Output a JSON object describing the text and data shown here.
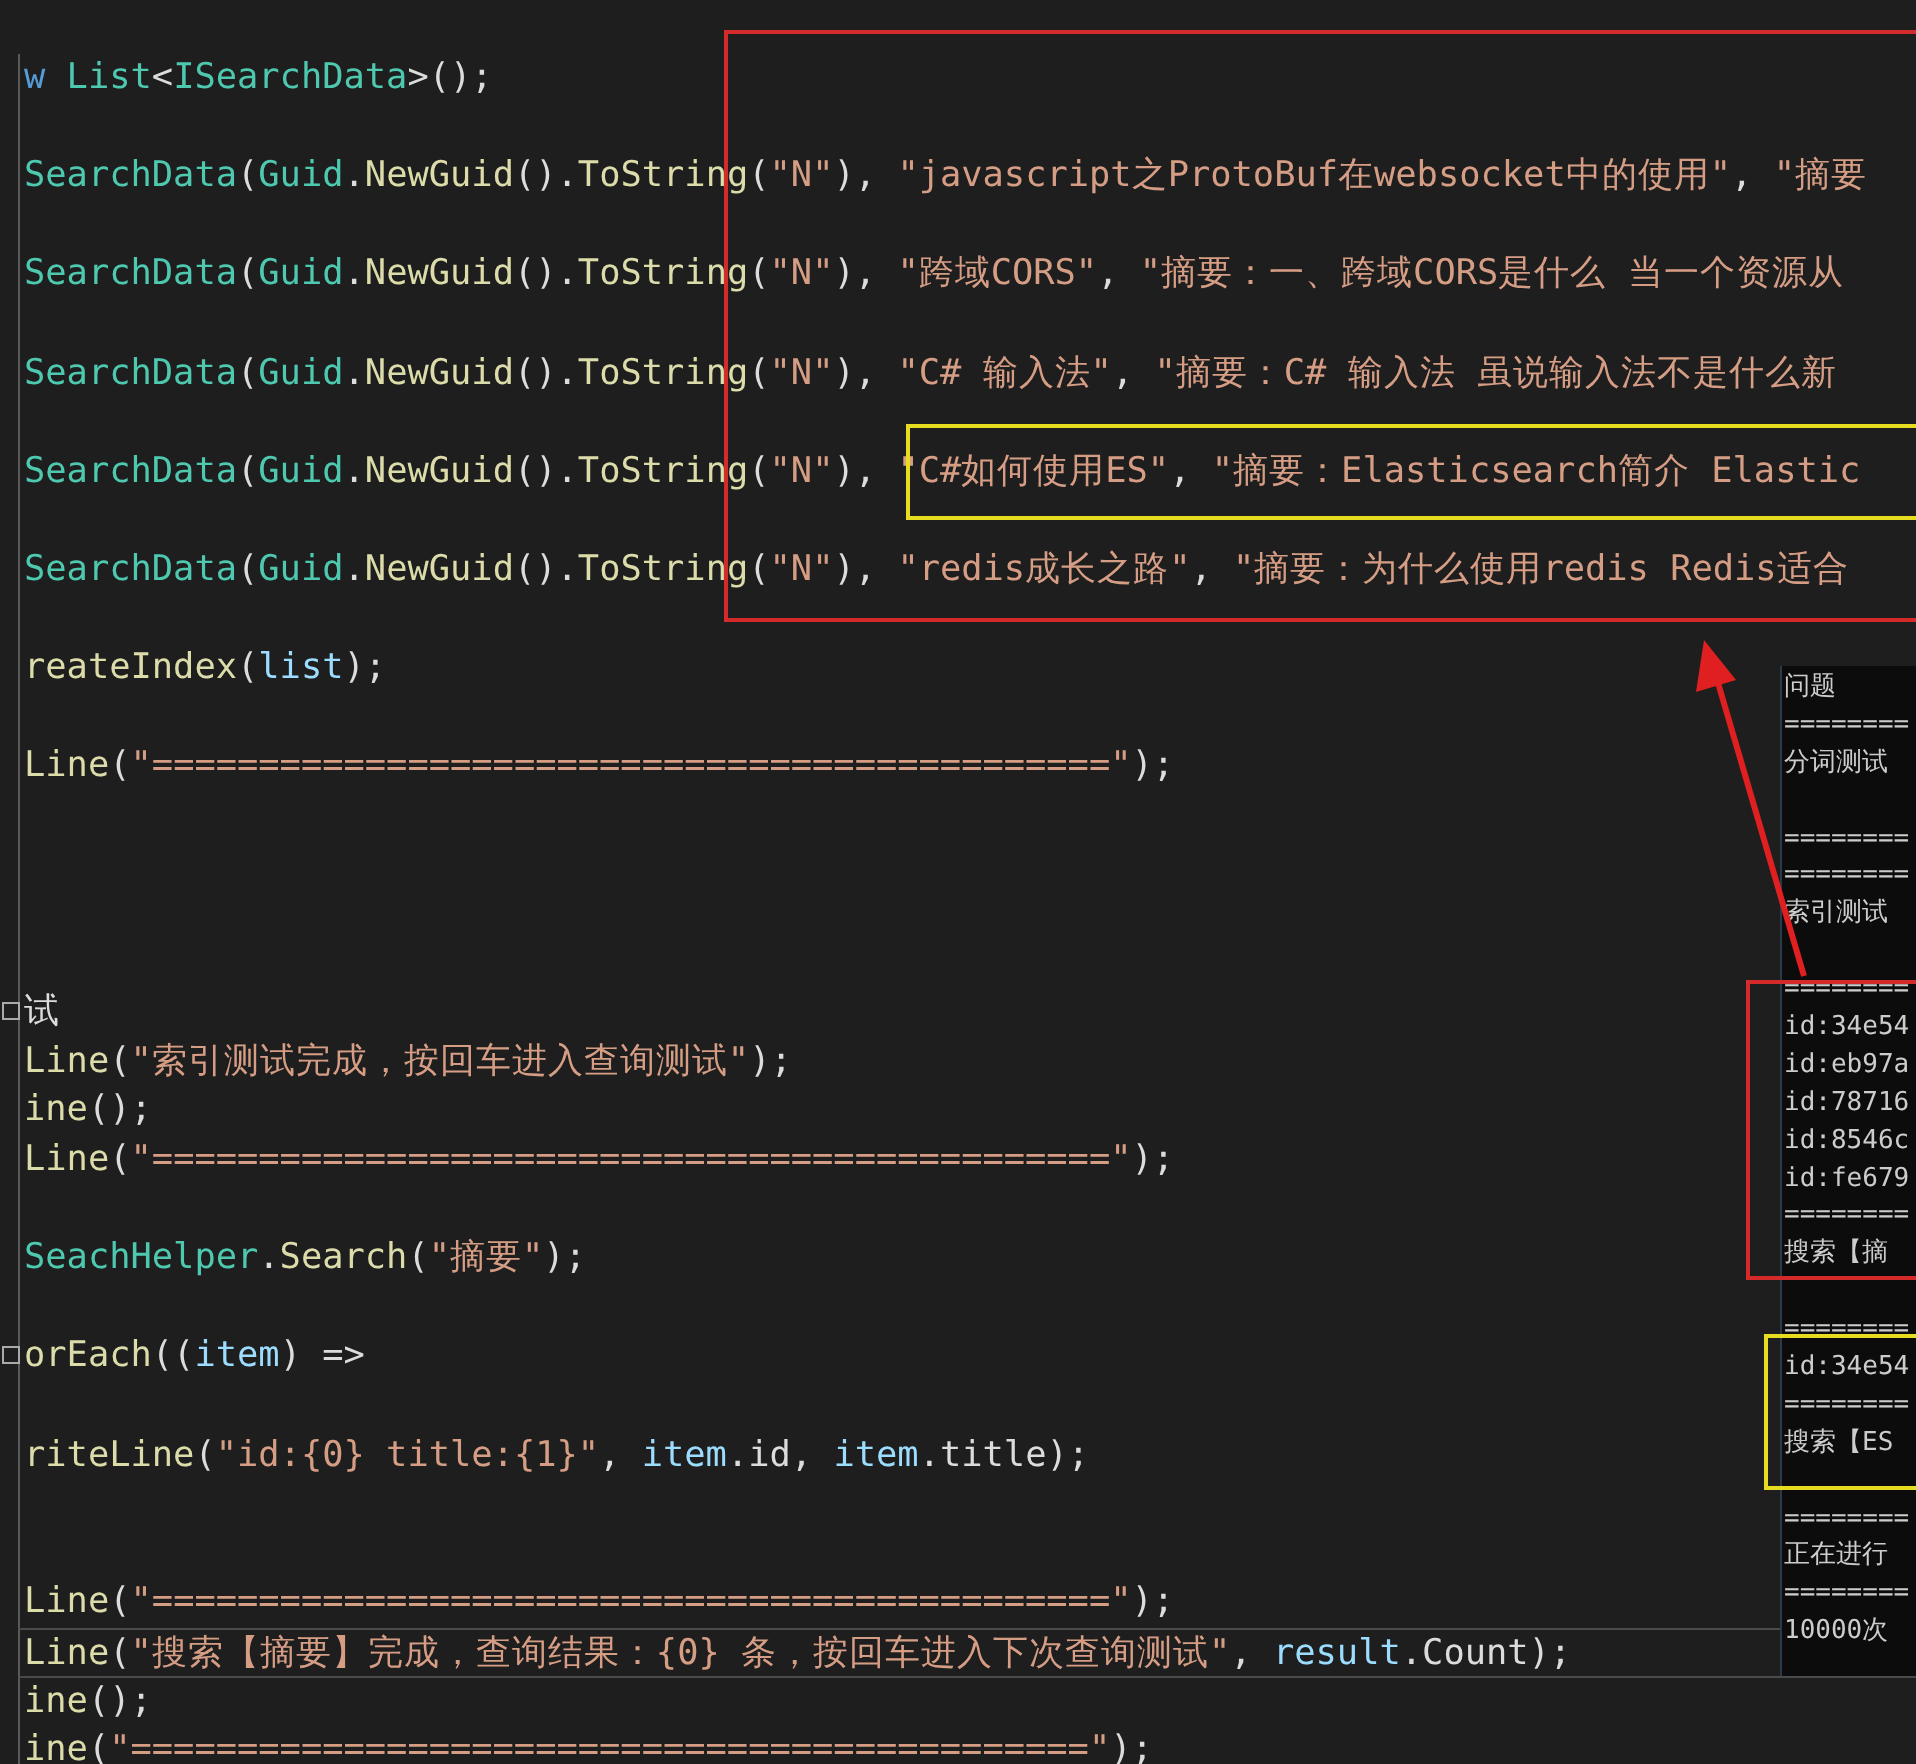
{
  "editor": {
    "lines": [
      {
        "kind": "code",
        "fold": false,
        "current": false,
        "tokens": [
          {
            "kind": "keyword",
            "text": "w"
          },
          {
            "kind": "type",
            "text": " List"
          },
          {
            "kind": "plain",
            "text": "<"
          },
          {
            "kind": "type",
            "text": "ISearchData"
          },
          {
            "kind": "plain",
            "text": ">();"
          }
        ]
      },
      {
        "kind": "blank"
      },
      {
        "kind": "code",
        "fold": false,
        "current": false,
        "tokens": [
          {
            "kind": "type",
            "text": "SearchData"
          },
          {
            "kind": "plain",
            "text": "("
          },
          {
            "kind": "type",
            "text": "Guid"
          },
          {
            "kind": "plain",
            "text": "."
          },
          {
            "kind": "method",
            "text": "NewGuid"
          },
          {
            "kind": "plain",
            "text": "()."
          },
          {
            "kind": "method",
            "text": "ToString"
          },
          {
            "kind": "plain",
            "text": "("
          },
          {
            "kind": "string",
            "text": "\"N\""
          },
          {
            "kind": "plain",
            "text": "), "
          },
          {
            "kind": "string",
            "text": "\"javascript之ProtoBuf在websocket中的使用\""
          },
          {
            "kind": "plain",
            "text": ", "
          },
          {
            "kind": "string",
            "text": "\"摘要"
          }
        ]
      },
      {
        "kind": "blank"
      },
      {
        "kind": "code",
        "fold": false,
        "current": false,
        "tokens": [
          {
            "kind": "type",
            "text": "SearchData"
          },
          {
            "kind": "plain",
            "text": "("
          },
          {
            "kind": "type",
            "text": "Guid"
          },
          {
            "kind": "plain",
            "text": "."
          },
          {
            "kind": "method",
            "text": "NewGuid"
          },
          {
            "kind": "plain",
            "text": "()."
          },
          {
            "kind": "method",
            "text": "ToString"
          },
          {
            "kind": "plain",
            "text": "("
          },
          {
            "kind": "string",
            "text": "\"N\""
          },
          {
            "kind": "plain",
            "text": "), "
          },
          {
            "kind": "string",
            "text": "\"跨域CORS\""
          },
          {
            "kind": "plain",
            "text": ", "
          },
          {
            "kind": "string",
            "text": "\"摘要：一、跨域CORS是什么 当一个资源从"
          }
        ]
      },
      {
        "kind": "blank"
      },
      {
        "kind": "code",
        "fold": false,
        "current": false,
        "tokens": [
          {
            "kind": "type",
            "text": "SearchData"
          },
          {
            "kind": "plain",
            "text": "("
          },
          {
            "kind": "type",
            "text": "Guid"
          },
          {
            "kind": "plain",
            "text": "."
          },
          {
            "kind": "method",
            "text": "NewGuid"
          },
          {
            "kind": "plain",
            "text": "()."
          },
          {
            "kind": "method",
            "text": "ToString"
          },
          {
            "kind": "plain",
            "text": "("
          },
          {
            "kind": "string",
            "text": "\"N\""
          },
          {
            "kind": "plain",
            "text": "), "
          },
          {
            "kind": "string",
            "text": "\"C# 输入法\""
          },
          {
            "kind": "plain",
            "text": ", "
          },
          {
            "kind": "string",
            "text": "\"摘要：C# 输入法 虽说输入法不是什么新"
          }
        ]
      },
      {
        "kind": "blank"
      },
      {
        "kind": "code",
        "fold": false,
        "current": false,
        "tokens": [
          {
            "kind": "type",
            "text": "SearchData"
          },
          {
            "kind": "plain",
            "text": "("
          },
          {
            "kind": "type",
            "text": "Guid"
          },
          {
            "kind": "plain",
            "text": "."
          },
          {
            "kind": "method",
            "text": "NewGuid"
          },
          {
            "kind": "plain",
            "text": "()."
          },
          {
            "kind": "method",
            "text": "ToString"
          },
          {
            "kind": "plain",
            "text": "("
          },
          {
            "kind": "string",
            "text": "\"N\""
          },
          {
            "kind": "plain",
            "text": "), "
          },
          {
            "kind": "string",
            "text": "\"C#如何使用ES\""
          },
          {
            "kind": "plain",
            "text": ", "
          },
          {
            "kind": "string",
            "text": "\"摘要：Elasticsearch简介 Elastic"
          }
        ]
      },
      {
        "kind": "blank"
      },
      {
        "kind": "code",
        "fold": false,
        "current": false,
        "tokens": [
          {
            "kind": "type",
            "text": "SearchData"
          },
          {
            "kind": "plain",
            "text": "("
          },
          {
            "kind": "type",
            "text": "Guid"
          },
          {
            "kind": "plain",
            "text": "."
          },
          {
            "kind": "method",
            "text": "NewGuid"
          },
          {
            "kind": "plain",
            "text": "()."
          },
          {
            "kind": "method",
            "text": "ToString"
          },
          {
            "kind": "plain",
            "text": "("
          },
          {
            "kind": "string",
            "text": "\"N\""
          },
          {
            "kind": "plain",
            "text": "), "
          },
          {
            "kind": "string",
            "text": "\"redis成长之路\""
          },
          {
            "kind": "plain",
            "text": ", "
          },
          {
            "kind": "string",
            "text": "\"摘要：为什么使用redis Redis适合"
          }
        ]
      },
      {
        "kind": "blank"
      },
      {
        "kind": "code",
        "fold": false,
        "current": false,
        "tokens": [
          {
            "kind": "method",
            "text": "reateIndex"
          },
          {
            "kind": "plain",
            "text": "("
          },
          {
            "kind": "variable",
            "text": "list"
          },
          {
            "kind": "plain",
            "text": ");"
          }
        ]
      },
      {
        "kind": "blank"
      },
      {
        "kind": "code",
        "fold": false,
        "current": false,
        "tokens": [
          {
            "kind": "method",
            "text": "Line"
          },
          {
            "kind": "plain",
            "text": "("
          },
          {
            "kind": "string",
            "text": "\"=============================================\""
          },
          {
            "kind": "plain",
            "text": ");"
          }
        ]
      },
      {
        "kind": "blank"
      },
      {
        "kind": "blank"
      },
      {
        "kind": "blank"
      },
      {
        "kind": "blank"
      },
      {
        "kind": "code",
        "fold": true,
        "current": false,
        "tokens": [
          {
            "kind": "plain",
            "text": "试"
          }
        ]
      },
      {
        "kind": "code",
        "fold": false,
        "current": false,
        "tokens": [
          {
            "kind": "method",
            "text": "Line"
          },
          {
            "kind": "plain",
            "text": "("
          },
          {
            "kind": "string",
            "text": "\"索引测试完成，按回车进入查询测试\""
          },
          {
            "kind": "plain",
            "text": ");"
          }
        ]
      },
      {
        "kind": "code",
        "fold": false,
        "current": false,
        "tokens": [
          {
            "kind": "method",
            "text": "ine"
          },
          {
            "kind": "plain",
            "text": "();"
          }
        ]
      },
      {
        "kind": "code",
        "fold": false,
        "current": false,
        "tokens": [
          {
            "kind": "method",
            "text": "Line"
          },
          {
            "kind": "plain",
            "text": "("
          },
          {
            "kind": "string",
            "text": "\"=============================================\""
          },
          {
            "kind": "plain",
            "text": ");"
          }
        ]
      },
      {
        "kind": "blank"
      },
      {
        "kind": "code",
        "fold": false,
        "current": false,
        "tokens": [
          {
            "kind": "type",
            "text": "SeachHelper"
          },
          {
            "kind": "plain",
            "text": "."
          },
          {
            "kind": "method",
            "text": "Search"
          },
          {
            "kind": "plain",
            "text": "("
          },
          {
            "kind": "string",
            "text": "\"摘要\""
          },
          {
            "kind": "plain",
            "text": ");"
          }
        ]
      },
      {
        "kind": "blank"
      },
      {
        "kind": "code",
        "fold": true,
        "current": false,
        "tokens": [
          {
            "kind": "method",
            "text": "orEach"
          },
          {
            "kind": "plain",
            "text": "(("
          },
          {
            "kind": "variable",
            "text": "item"
          },
          {
            "kind": "plain",
            "text": ") =>"
          }
        ]
      },
      {
        "kind": "blank"
      },
      {
        "kind": "code",
        "fold": false,
        "current": false,
        "tokens": [
          {
            "kind": "method",
            "text": "riteLine"
          },
          {
            "kind": "plain",
            "text": "("
          },
          {
            "kind": "string",
            "text": "\"id:{0} title:{1}\""
          },
          {
            "kind": "plain",
            "text": ", "
          },
          {
            "kind": "variable",
            "text": "item"
          },
          {
            "kind": "plain",
            "text": ".id, "
          },
          {
            "kind": "variable",
            "text": "item"
          },
          {
            "kind": "plain",
            "text": ".title);"
          }
        ]
      },
      {
        "kind": "blank"
      },
      {
        "kind": "blank"
      },
      {
        "kind": "code",
        "fold": false,
        "current": false,
        "tokens": [
          {
            "kind": "method",
            "text": "Line"
          },
          {
            "kind": "plain",
            "text": "("
          },
          {
            "kind": "string",
            "text": "\"=============================================\""
          },
          {
            "kind": "plain",
            "text": ");"
          }
        ]
      },
      {
        "kind": "code",
        "fold": false,
        "current": true,
        "tokens": [
          {
            "kind": "method",
            "text": "Line"
          },
          {
            "kind": "plain",
            "text": "("
          },
          {
            "kind": "string",
            "text": "\"搜索【摘要】完成，查询结果：{0} 条，按回车进入下次查询测试\""
          },
          {
            "kind": "plain",
            "text": ", "
          },
          {
            "kind": "variable",
            "text": "result"
          },
          {
            "kind": "plain",
            "text": ".Count);"
          }
        ]
      },
      {
        "kind": "code",
        "fold": false,
        "current": false,
        "tokens": [
          {
            "kind": "method",
            "text": "ine"
          },
          {
            "kind": "plain",
            "text": "();"
          }
        ]
      },
      {
        "kind": "code",
        "fold": false,
        "current": false,
        "tokens": [
          {
            "kind": "method",
            "text": "ine"
          },
          {
            "kind": "plain",
            "text": "("
          },
          {
            "kind": "string",
            "text": "\"=============================================\""
          },
          {
            "kind": "plain",
            "text": ");"
          }
        ]
      }
    ]
  },
  "console": {
    "blocks": [
      [
        "问题",
        "========",
        "分词测试"
      ],
      [
        "========",
        "========",
        "索引测试"
      ],
      [
        "========",
        "id:34e54",
        "id:eb97a",
        "id:78716",
        "id:8546c",
        "id:fe679",
        "========",
        "搜索【摘"
      ],
      [
        "========",
        "id:34e54",
        "========",
        "搜索【ES"
      ],
      [
        "========",
        "正在进行",
        "========",
        "10000次"
      ]
    ]
  }
}
